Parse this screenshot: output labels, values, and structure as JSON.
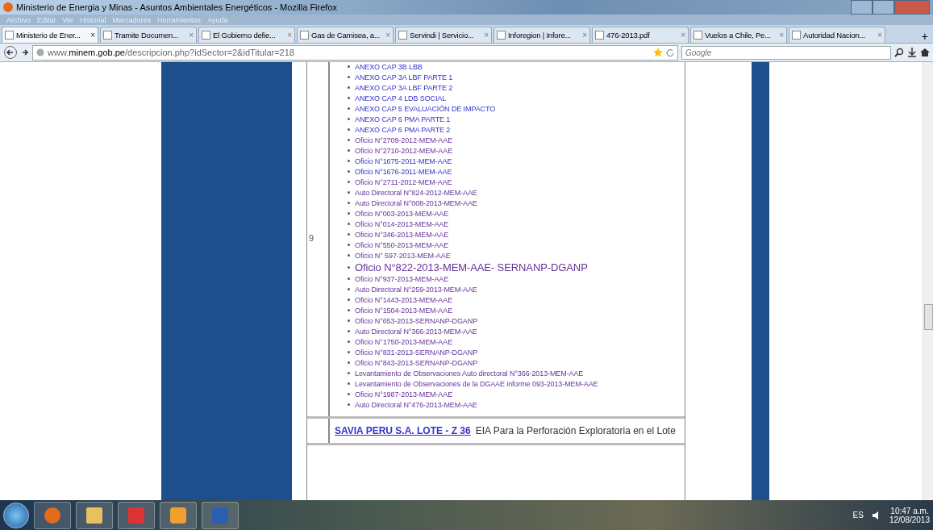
{
  "window": {
    "title": "Ministerio de Energia y Minas - Asuntos Ambientales Energéticos - Mozilla Firefox"
  },
  "menu": [
    "Archivo",
    "Editar",
    "Ver",
    "Historial",
    "Marcadores",
    "Herramientas",
    "Ayuda"
  ],
  "tabs": [
    {
      "label": "Ministerio de Ener...",
      "selected": true
    },
    {
      "label": "Tramite Documen...",
      "selected": false
    },
    {
      "label": "El Gobierno defie...",
      "selected": false
    },
    {
      "label": "Gas de Camisea, a...",
      "selected": false
    },
    {
      "label": "Servindi | Servicio...",
      "selected": false
    },
    {
      "label": "Inforegion | Infore...",
      "selected": false
    },
    {
      "label": "476-2013.pdf",
      "selected": false
    },
    {
      "label": "Vuelos a Chile, Pe...",
      "selected": false
    },
    {
      "label": "Autoridad Nacion...",
      "selected": false
    }
  ],
  "tab_close": "×",
  "new_tab": "+",
  "address": "www.**minem.gob.pe**/descripcion.php?idSector=2&idTitular=218",
  "search": {
    "placeholder": "Google"
  },
  "table": {
    "rows": [
      {
        "number": "9",
        "documents": [
          {
            "text": "ANEXO CAP 3B LBB",
            "visited": false,
            "kind": "normal"
          },
          {
            "text": "ANEXO CAP 3A LBF PARTE 1",
            "visited": false,
            "kind": "normal"
          },
          {
            "text": "ANEXO CAP 3A LBF PARTE 2",
            "visited": false,
            "kind": "normal"
          },
          {
            "text": "ANEXO CAP 4 LDB SOCIAL",
            "visited": false,
            "kind": "normal"
          },
          {
            "text": "ANEXO CAP 5 EVALUACIÓN DE IMPACTO",
            "visited": false,
            "kind": "normal"
          },
          {
            "text": "ANEXO CAP 6 PMA PARTE 1",
            "visited": false,
            "kind": "normal"
          },
          {
            "text": "ANEXO CAP 6 PMA PARTE 2",
            "visited": false,
            "kind": "normal"
          },
          {
            "text": "Oficio N°2709-2012-MEM-AAE",
            "visited": true,
            "kind": "normal"
          },
          {
            "text": "Oficio N°2710-2012-MEM-AAE",
            "visited": true,
            "kind": "normal"
          },
          {
            "text": "Oficio N°1675-2011-MEM-AAE",
            "visited": false,
            "kind": "normal"
          },
          {
            "text": "Oficio N°1676-2011-MEM-AAE",
            "visited": false,
            "kind": "normal"
          },
          {
            "text": "Oficio N°2711-2012-MEM-AAE",
            "visited": true,
            "kind": "normal"
          },
          {
            "text": "Auto Directoral N°824-2012-MEM-AAE",
            "visited": true,
            "kind": "normal"
          },
          {
            "text": "Auto Directoral N°008-2013-MEM-AAE",
            "visited": true,
            "kind": "normal"
          },
          {
            "text": "Oficio N°003-2013-MEM-AAE",
            "visited": true,
            "kind": "normal"
          },
          {
            "text": "Oficio N°014-2013-MEM-AAE",
            "visited": true,
            "kind": "normal"
          },
          {
            "text": "Oficio N°346-2013-MEM-AAE",
            "visited": true,
            "kind": "normal"
          },
          {
            "text": "Oficio N°550-2013-MEM-AAE",
            "visited": true,
            "kind": "normal"
          },
          {
            "text": "Oficio N° 597-2013-MEM-AAE",
            "visited": true,
            "kind": "normal"
          },
          {
            "text": "Oficio N°822-2013-MEM-AAE- SERNANP-DGANP",
            "visited": true,
            "kind": "large"
          },
          {
            "text": "Oficio N°937-2013-MEM-AAE",
            "visited": true,
            "kind": "normal"
          },
          {
            "text": "Auto Directoral N°259-2013-MEM-AAE",
            "visited": true,
            "kind": "normal"
          },
          {
            "text": "Oficio N°1443-2013-MEM-AAE",
            "visited": true,
            "kind": "normal"
          },
          {
            "text": "Oficio N°1504-2013-MEM-AAE",
            "visited": true,
            "kind": "normal"
          },
          {
            "text": "Oficio N°653-2013-SERNANP-DGANP",
            "visited": true,
            "kind": "normal"
          },
          {
            "text": "Auto Directoral N°366-2013-MEM-AAE",
            "visited": true,
            "kind": "normal"
          },
          {
            "text": "Oficio N°1750-2013-MEM-AAE",
            "visited": true,
            "kind": "normal"
          },
          {
            "text": "Oficio N°831-2013-SERNANP-DGANP",
            "visited": true,
            "kind": "normal"
          },
          {
            "text": "Oficio N°843-2013-SERNANP-DGANP",
            "visited": true,
            "kind": "normal"
          },
          {
            "text": "Levantamiento de Observaciones Auto directoral N°366-2013-MEM-AAE",
            "visited": true,
            "kind": "normal"
          },
          {
            "text": "Levantamiento de Observaciones de la DGAAE informe 093-2013-MEM-AAE",
            "visited": true,
            "kind": "normal"
          },
          {
            "text": "Oficio N°1987-2013-MEM-AAE",
            "visited": true,
            "kind": "normal"
          },
          {
            "text": "Auto Directoral N°476-2013-MEM-AAE",
            "visited": true,
            "kind": "normal"
          }
        ]
      }
    ],
    "next_row": {
      "link": "SAVIA PERU S.A. LOTE - Z 36",
      "description": "EIA Para la Perforación Exploratoria en el Lote"
    }
  },
  "taskbar": {
    "language": "ES",
    "time": "10:47 a.m.",
    "date": "12/08/2013"
  }
}
